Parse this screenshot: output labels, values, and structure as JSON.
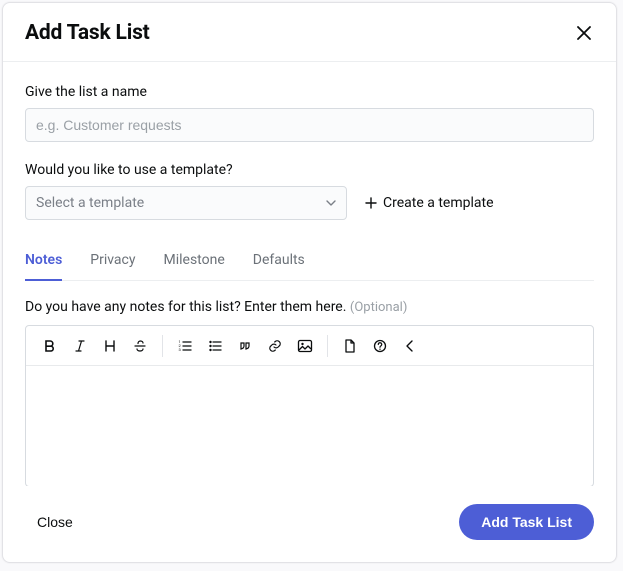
{
  "header": {
    "title": "Add Task List"
  },
  "name_field": {
    "label": "Give the list a name",
    "placeholder": "e.g. Customer requests",
    "value": ""
  },
  "template": {
    "label": "Would you like to use a template?",
    "select_placeholder": "Select a template",
    "create_label": "Create a template"
  },
  "tabs": [
    {
      "label": "Notes",
      "active": true
    },
    {
      "label": "Privacy",
      "active": false
    },
    {
      "label": "Milestone",
      "active": false
    },
    {
      "label": "Defaults",
      "active": false
    }
  ],
  "notes": {
    "label": "Do you have any notes for this list? Enter them here.",
    "optional": "(Optional)",
    "value": ""
  },
  "footer": {
    "close": "Close",
    "submit": "Add Task List"
  }
}
